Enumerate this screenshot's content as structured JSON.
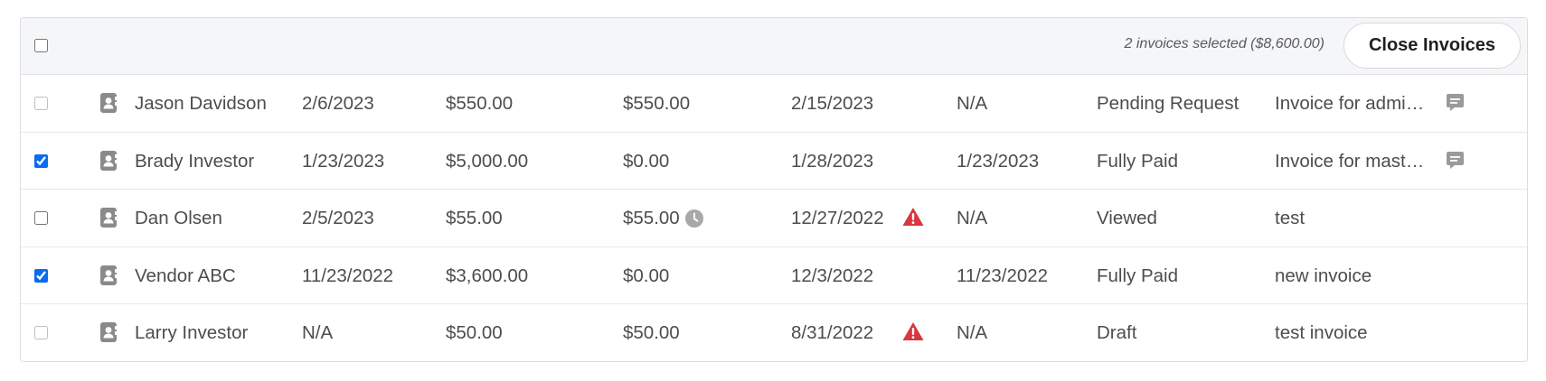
{
  "header": {
    "selection_summary": "2 invoices selected ($8,600.00)",
    "close_button_label": "Close Invoices"
  },
  "colors": {
    "accent": "#0a6cf0",
    "warning": "#d9363e",
    "icon_gray": "#8a8a8a"
  },
  "rows": [
    {
      "name": "Jason Davidson",
      "invoice_date": "2/6/2023",
      "amount": "$550.00",
      "balance": "$550.00",
      "due_date": "2/15/2023",
      "paid_date": "N/A",
      "status": "Pending Request",
      "description": "Invoice for admi…",
      "checked": false,
      "disabled": true,
      "overdue": false,
      "has_clock": false,
      "has_comment": true
    },
    {
      "name": "Brady Investor",
      "invoice_date": "1/23/2023",
      "amount": "$5,000.00",
      "balance": "$0.00",
      "due_date": "1/28/2023",
      "paid_date": "1/23/2023",
      "status": "Fully Paid",
      "description": "Invoice for mast…",
      "checked": true,
      "disabled": false,
      "overdue": false,
      "has_clock": false,
      "has_comment": true
    },
    {
      "name": "Dan Olsen",
      "invoice_date": "2/5/2023",
      "amount": "$55.00",
      "balance": "$55.00",
      "due_date": "12/27/2022",
      "paid_date": "N/A",
      "status": "Viewed",
      "description": "test",
      "checked": false,
      "disabled": false,
      "overdue": true,
      "has_clock": true,
      "has_comment": false
    },
    {
      "name": "Vendor ABC",
      "invoice_date": "11/23/2022",
      "amount": "$3,600.00",
      "balance": "$0.00",
      "due_date": "12/3/2022",
      "paid_date": "11/23/2022",
      "status": "Fully Paid",
      "description": "new invoice",
      "checked": true,
      "disabled": false,
      "overdue": false,
      "has_clock": false,
      "has_comment": false
    },
    {
      "name": "Larry Investor",
      "invoice_date": "N/A",
      "amount": "$50.00",
      "balance": "$50.00",
      "due_date": "8/31/2022",
      "paid_date": "N/A",
      "status": "Draft",
      "description": "test invoice",
      "checked": false,
      "disabled": true,
      "overdue": true,
      "has_clock": false,
      "has_comment": false
    }
  ]
}
